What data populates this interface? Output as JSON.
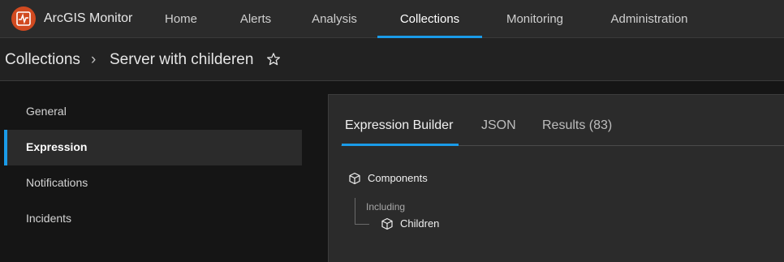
{
  "app": {
    "title": "ArcGIS Monitor"
  },
  "nav": {
    "items": [
      {
        "label": "Home",
        "active": false
      },
      {
        "label": "Alerts",
        "active": false
      },
      {
        "label": "Analysis",
        "active": false
      },
      {
        "label": "Collections",
        "active": true
      },
      {
        "label": "Monitoring",
        "active": false
      },
      {
        "label": "Administration",
        "active": false
      }
    ]
  },
  "breadcrumb": {
    "root": "Collections",
    "separator": "›",
    "current": "Server with childeren"
  },
  "side_menu": {
    "items": [
      {
        "label": "General",
        "active": false
      },
      {
        "label": "Expression",
        "active": true
      },
      {
        "label": "Notifications",
        "active": false
      },
      {
        "label": "Incidents",
        "active": false
      }
    ]
  },
  "tabs": [
    {
      "label": "Expression Builder",
      "active": true
    },
    {
      "label": "JSON",
      "active": false
    },
    {
      "label": "Results (83)",
      "active": false
    }
  ],
  "expression": {
    "root_label": "Components",
    "relation_label": "Including",
    "child_label": "Children"
  },
  "colors": {
    "accent": "#1a9be8",
    "logo": "#d14a20",
    "background": "#151515",
    "panel": "#2b2b2b"
  },
  "icons": {
    "logo": "arcgis-monitor-logo-icon",
    "favorite": "star-outline-icon",
    "component": "cube-icon"
  }
}
